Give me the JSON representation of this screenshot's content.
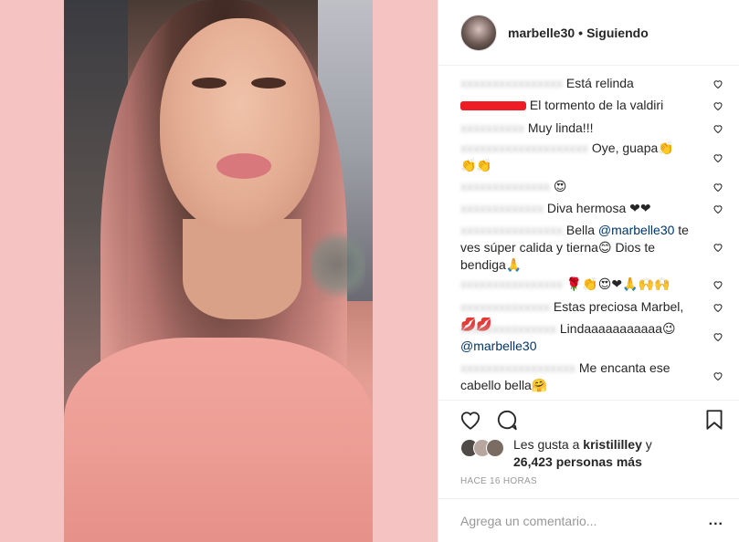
{
  "post": {
    "username": "marbelle30",
    "separator": "•",
    "follow_status": "Siguiendo"
  },
  "comments": [
    {
      "text": "Está relinda"
    },
    {
      "text": "El tormento de la valdiri"
    },
    {
      "text": "Muy linda!!!"
    },
    {
      "text": "Oye, guapa👏",
      "line2": "👏👏"
    },
    {
      "text": "😍"
    },
    {
      "text": "Diva hermosa ❤❤"
    },
    {
      "text": "Bella ",
      "mention": "@marbelle30",
      "rest": " te",
      "line2": "ves súper calida y tierna😊 Dios te",
      "line3": "bendiga🙏"
    },
    {
      "text": "🌹👏😍❤🙏🙌🙌"
    },
    {
      "text": "Estas preciosa Marbel, 💋💋"
    },
    {
      "text": "Lindaaaaaaaaaaa😉",
      "line2_mention": "@marbelle30"
    },
    {
      "text": "Me encanta ese",
      "line2": "cabello bella🤗"
    }
  ],
  "likes": {
    "prefix": "Les gusta a ",
    "user": "kristililley",
    "joiner": " y",
    "count": "26,423 personas más"
  },
  "timestamp": "HACE 16 HORAS",
  "comment_input": {
    "placeholder": "Agrega un comentario...",
    "more": "..."
  },
  "icons": [
    "heart-icon",
    "comment-icon",
    "bookmark-icon",
    "more-options-icon"
  ]
}
